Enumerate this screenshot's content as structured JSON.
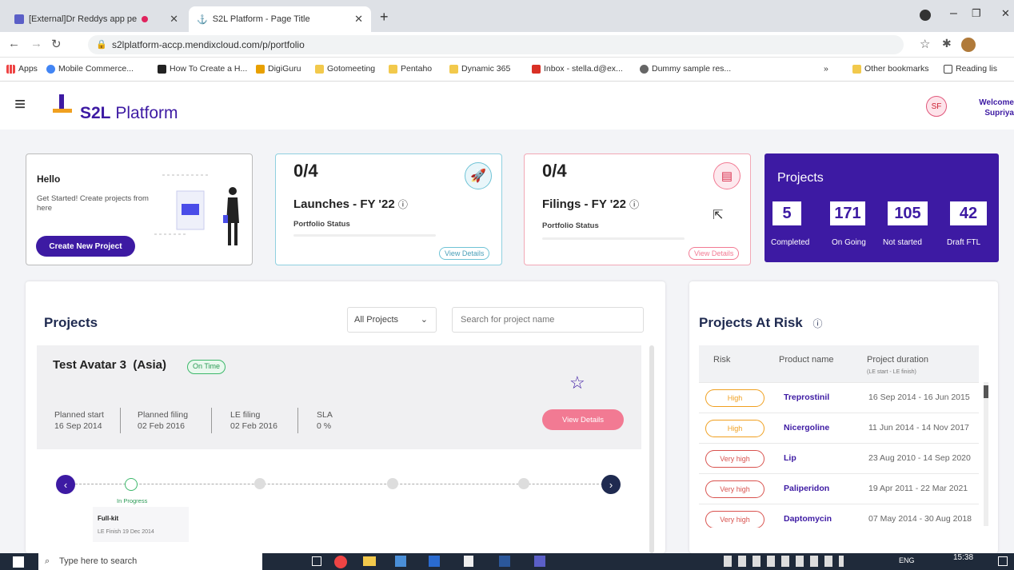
{
  "browser": {
    "tabs": [
      {
        "label": "[External]Dr Reddys app pe"
      },
      {
        "label": "S2L Platform - Page Title"
      }
    ],
    "url": "s2lplatform-accp.mendixcloud.com/p/portfolio",
    "bookmarks": [
      "Apps",
      "Mobile Commerce...",
      "How To Create a H...",
      "DigiGuru",
      "Gotomeeting",
      "Pentaho",
      "Dynamic 365",
      "Inbox - stella.d@ex...",
      "Dummy sample res...",
      "»",
      "Other bookmarks",
      "Reading lis"
    ]
  },
  "header": {
    "brand_bold": "S2L",
    "brand_rest": "Platform",
    "avatar": "SF",
    "welcome": "Welcome",
    "user": "Supriya"
  },
  "hello_card": {
    "title": "Hello",
    "text": "Get Started! Create projects from here",
    "button": "Create New Project"
  },
  "launches_card": {
    "count": "0/4",
    "title": "Launches - FY '22",
    "sub": "Portfolio Status",
    "link": "View Details"
  },
  "filings_card": {
    "count": "0/4",
    "title": "Filings - FY '22",
    "sub": "Portfolio Status",
    "link": "View Details"
  },
  "projects_summary": {
    "title": "Projects",
    "items": [
      {
        "value": "5",
        "label": "Completed"
      },
      {
        "value": "171",
        "label": "On Going"
      },
      {
        "value": "105",
        "label": "Not started"
      },
      {
        "value": "42",
        "label": "Draft FTL"
      }
    ]
  },
  "projects_panel": {
    "title": "Projects",
    "filter": "All Projects",
    "search_placeholder": "Search for project name",
    "project": {
      "name": "Test Avatar 3",
      "region": "(Asia)",
      "status": "On Time",
      "fields": [
        {
          "label": "Planned start",
          "value": "16 Sep 2014"
        },
        {
          "label": "Planned filing",
          "value": "02 Feb 2016"
        },
        {
          "label": "LE filing",
          "value": "02 Feb 2016"
        },
        {
          "label": "SLA",
          "value": "0 %"
        }
      ],
      "button": "View Details",
      "timeline_status": "In Progress",
      "milestone": "Full-kit",
      "milestone_date": "LE Finish 19 Dec 2014"
    }
  },
  "risk_panel": {
    "title": "Projects At Risk",
    "columns": [
      "Risk",
      "Product name",
      "Project duration"
    ],
    "duration_sub": "(LE start - LE finish)",
    "rows": [
      {
        "risk": "High",
        "product": "Treprostinil",
        "duration": "16 Sep 2014 - 16 Jun 2015"
      },
      {
        "risk": "High",
        "product": "Nicergoline",
        "duration": "11 Jun 2014 - 14 Nov 2017"
      },
      {
        "risk": "Very high",
        "product": "Lip",
        "duration": "23 Aug 2010 - 14 Sep 2020"
      },
      {
        "risk": "Very high",
        "product": "Paliperidon",
        "duration": "19 Apr 2011 - 22 Mar 2021"
      },
      {
        "risk": "Very high",
        "product": "Daptomycin",
        "duration": "07 May 2014 - 30 Aug 2018"
      }
    ],
    "colors": {
      "high": "#f0a020",
      "very_high": "#d9534f"
    }
  },
  "taskbar": {
    "search": "Type here to search",
    "lang": "ENG",
    "time": "15:38"
  },
  "colors": {
    "brand": "#3d1aa3",
    "accent_pink": "#f27a93",
    "teal": "#6fc3d6",
    "green": "#3db86b"
  }
}
